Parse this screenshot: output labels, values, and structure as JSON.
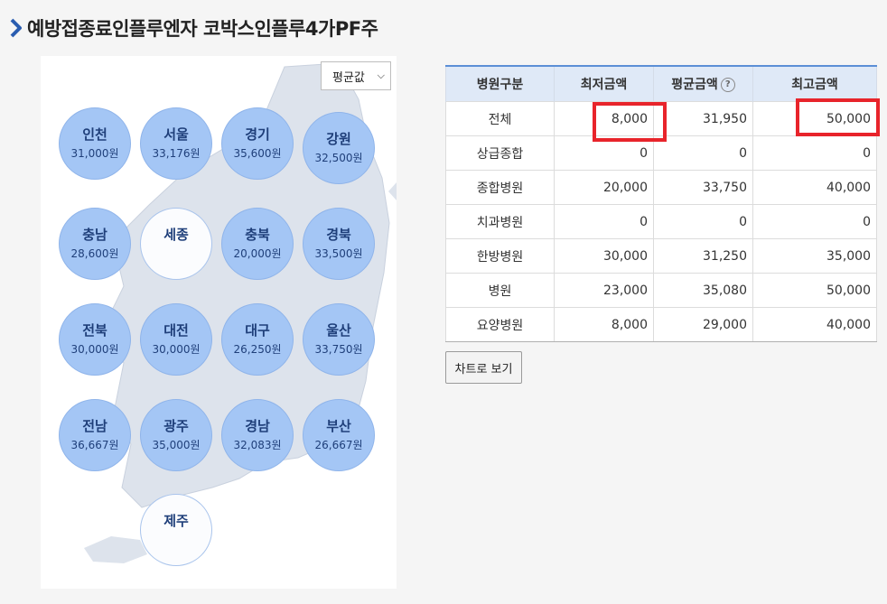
{
  "page_title": "예방접종료인플루엔자 코박스인플루4가PF주",
  "map": {
    "select_value": "평균값",
    "regions": [
      {
        "name": "인천",
        "price": "31,000원"
      },
      {
        "name": "서울",
        "price": "33,176원"
      },
      {
        "name": "경기",
        "price": "35,600원"
      },
      {
        "name": "강원",
        "price": "32,500원"
      },
      {
        "name": "충남",
        "price": "28,600원"
      },
      {
        "name": "세종",
        "price": ""
      },
      {
        "name": "충북",
        "price": "20,000원"
      },
      {
        "name": "경북",
        "price": "33,500원"
      },
      {
        "name": "전북",
        "price": "30,000원"
      },
      {
        "name": "대전",
        "price": "30,000원"
      },
      {
        "name": "대구",
        "price": "26,250원"
      },
      {
        "name": "울산",
        "price": "33,750원"
      },
      {
        "name": "전남",
        "price": "36,667원"
      },
      {
        "name": "광주",
        "price": "35,000원"
      },
      {
        "name": "경남",
        "price": "32,083원"
      },
      {
        "name": "부산",
        "price": "26,667원"
      },
      {
        "name": "제주",
        "price": ""
      }
    ]
  },
  "table": {
    "headers": [
      "병원구분",
      "최저금액",
      "평균금액",
      "최고금액"
    ],
    "help_icon": "?",
    "rows": [
      [
        "전체",
        "8,000",
        "31,950",
        "50,000"
      ],
      [
        "상급종합",
        "0",
        "0",
        "0"
      ],
      [
        "종합병원",
        "20,000",
        "33,750",
        "40,000"
      ],
      [
        "치과병원",
        "0",
        "0",
        "0"
      ],
      [
        "한방병원",
        "30,000",
        "31,250",
        "35,000"
      ],
      [
        "병원",
        "23,000",
        "35,080",
        "50,000"
      ],
      [
        "요양병원",
        "8,000",
        "29,000",
        "40,000"
      ]
    ]
  },
  "chart_button_label": "차트로 보기",
  "colors": {
    "highlight": "#e8242b",
    "region_fill": "#a4c6f5",
    "header_bg": "#dfe9f7",
    "accent": "#5b8fd6"
  }
}
